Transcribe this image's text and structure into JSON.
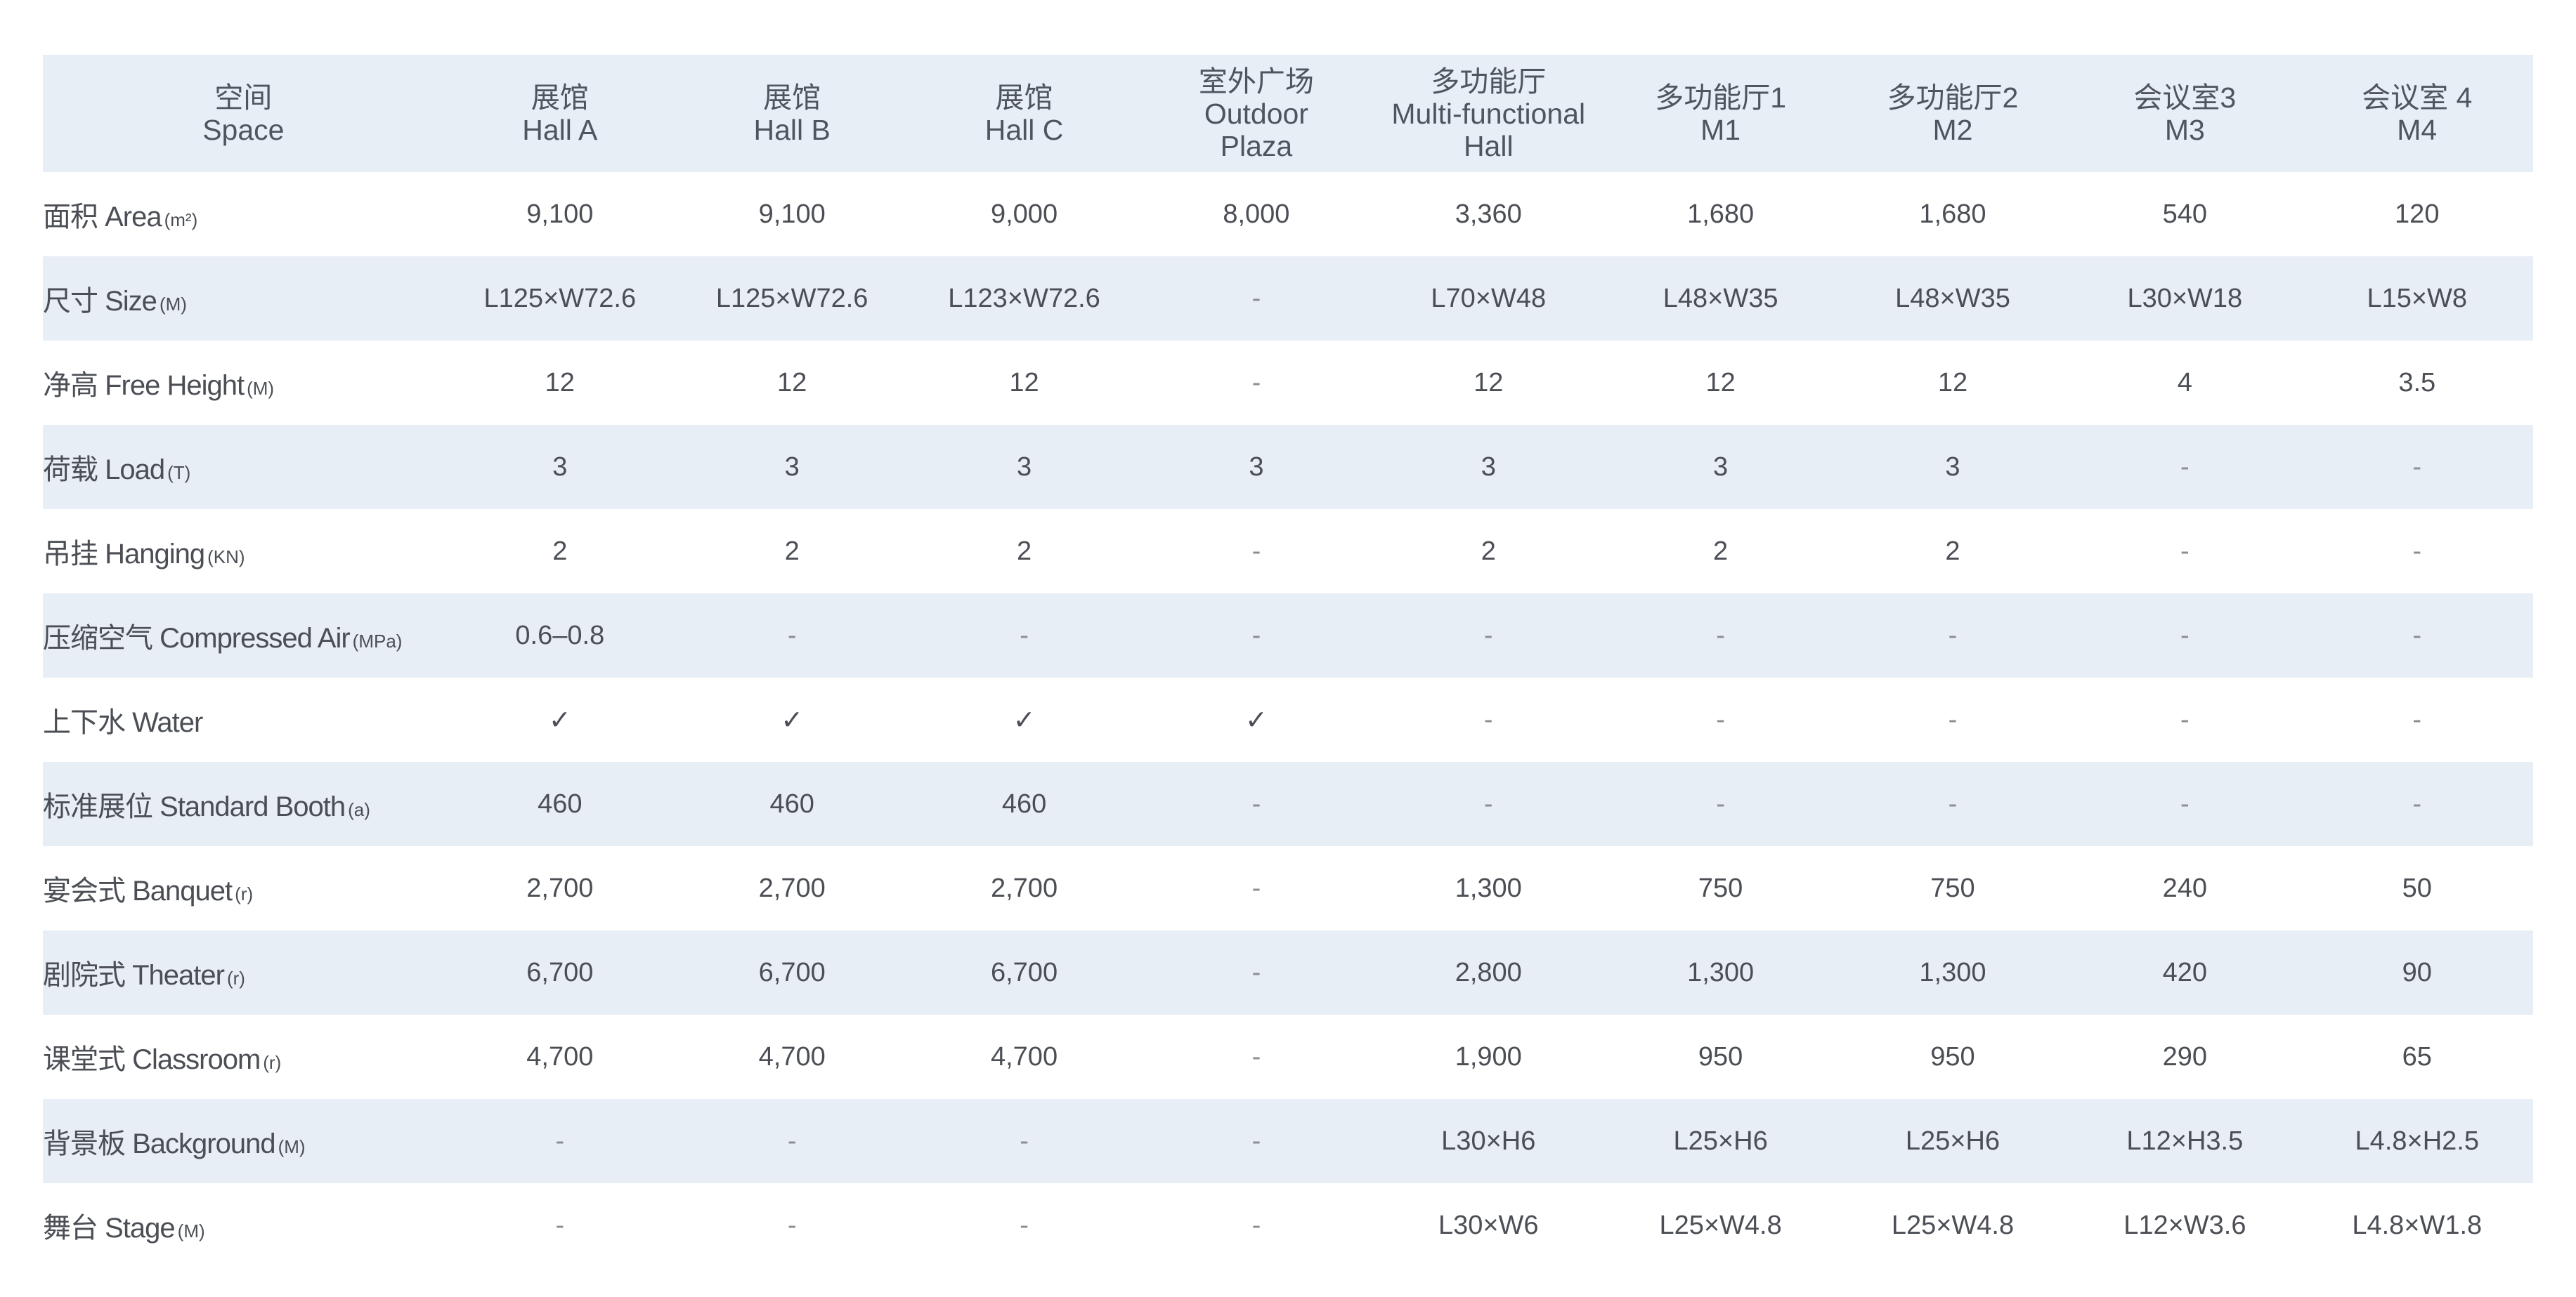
{
  "table": {
    "header_space": {
      "zh": "空间",
      "en": "Space"
    },
    "columns": [
      {
        "zh": "展馆",
        "en": "Hall A"
      },
      {
        "zh": "展馆",
        "en": "Hall B"
      },
      {
        "zh": "展馆",
        "en": "Hall C"
      },
      {
        "zh": "室外广场",
        "en": "Outdoor",
        "en2": "Plaza"
      },
      {
        "zh": "多功能厅",
        "en": "Multi-functional",
        "en2": "Hall"
      },
      {
        "zh": "多功能厅1",
        "en": "M1"
      },
      {
        "zh": "多功能厅2",
        "en": "M2"
      },
      {
        "zh": "会议室3",
        "en": "M3"
      },
      {
        "zh": "会议室 4",
        "en": "M4"
      }
    ],
    "rows": [
      {
        "label": "面积 Area",
        "unit": "(m²)",
        "shaded": false,
        "values": [
          "9,100",
          "9,100",
          "9,000",
          "8,000",
          "3,360",
          "1,680",
          "1,680",
          "540",
          "120"
        ]
      },
      {
        "label": "尺寸 Size",
        "unit": "(M)",
        "shaded": true,
        "values": [
          "L125×W72.6",
          "L125×W72.6",
          "L123×W72.6",
          "-",
          "L70×W48",
          "L48×W35",
          "L48×W35",
          "L30×W18",
          "L15×W8"
        ]
      },
      {
        "label": "净高 Free Height",
        "unit": "(M)",
        "shaded": false,
        "values": [
          "12",
          "12",
          "12",
          "-",
          "12",
          "12",
          "12",
          "4",
          "3.5"
        ]
      },
      {
        "label": "荷载 Load",
        "unit": "(T)",
        "shaded": true,
        "values": [
          "3",
          "3",
          "3",
          "3",
          "3",
          "3",
          "3",
          "-",
          "-"
        ]
      },
      {
        "label": "吊挂 Hanging",
        "unit": "(KN)",
        "shaded": false,
        "values": [
          "2",
          "2",
          "2",
          "-",
          "2",
          "2",
          "2",
          "-",
          "-"
        ]
      },
      {
        "label": "压缩空气 Compressed Air",
        "unit": "(MPa)",
        "shaded": true,
        "values": [
          "0.6–0.8",
          "-",
          "-",
          "-",
          "-",
          "-",
          "-",
          "-",
          "-"
        ]
      },
      {
        "label": "上下水 Water",
        "unit": "",
        "shaded": false,
        "values": [
          "✓",
          "✓",
          "✓",
          "✓",
          "-",
          "-",
          "-",
          "-",
          "-"
        ]
      },
      {
        "label": "标准展位 Standard Booth",
        "unit": "(a)",
        "shaded": true,
        "values": [
          "460",
          "460",
          "460",
          "-",
          "-",
          "-",
          "-",
          "-",
          "-"
        ]
      },
      {
        "label": "宴会式 Banquet",
        "unit": "(r)",
        "shaded": false,
        "values": [
          "2,700",
          "2,700",
          "2,700",
          "-",
          "1,300",
          "750",
          "750",
          "240",
          "50"
        ]
      },
      {
        "label": "剧院式 Theater",
        "unit": "(r)",
        "shaded": true,
        "values": [
          "6,700",
          "6,700",
          "6,700",
          "-",
          "2,800",
          "1,300",
          "1,300",
          "420",
          "90"
        ]
      },
      {
        "label": "课堂式 Classroom",
        "unit": "(r)",
        "shaded": false,
        "values": [
          "4,700",
          "4,700",
          "4,700",
          "-",
          "1,900",
          "950",
          "950",
          "290",
          "65"
        ]
      },
      {
        "label": "背景板 Background",
        "unit": "(M)",
        "shaded": true,
        "values": [
          "-",
          "-",
          "-",
          "-",
          "L30×H6",
          "L25×H6",
          "L25×H6",
          "L12×H3.5",
          "L4.8×H2.5"
        ]
      },
      {
        "label": "舞台 Stage",
        "unit": "(M)",
        "shaded": false,
        "values": [
          "-",
          "-",
          "-",
          "-",
          "L30×W6",
          "L25×W4.8",
          "L25×W4.8",
          "L12×W3.6",
          "L4.8×W1.8"
        ]
      }
    ]
  }
}
